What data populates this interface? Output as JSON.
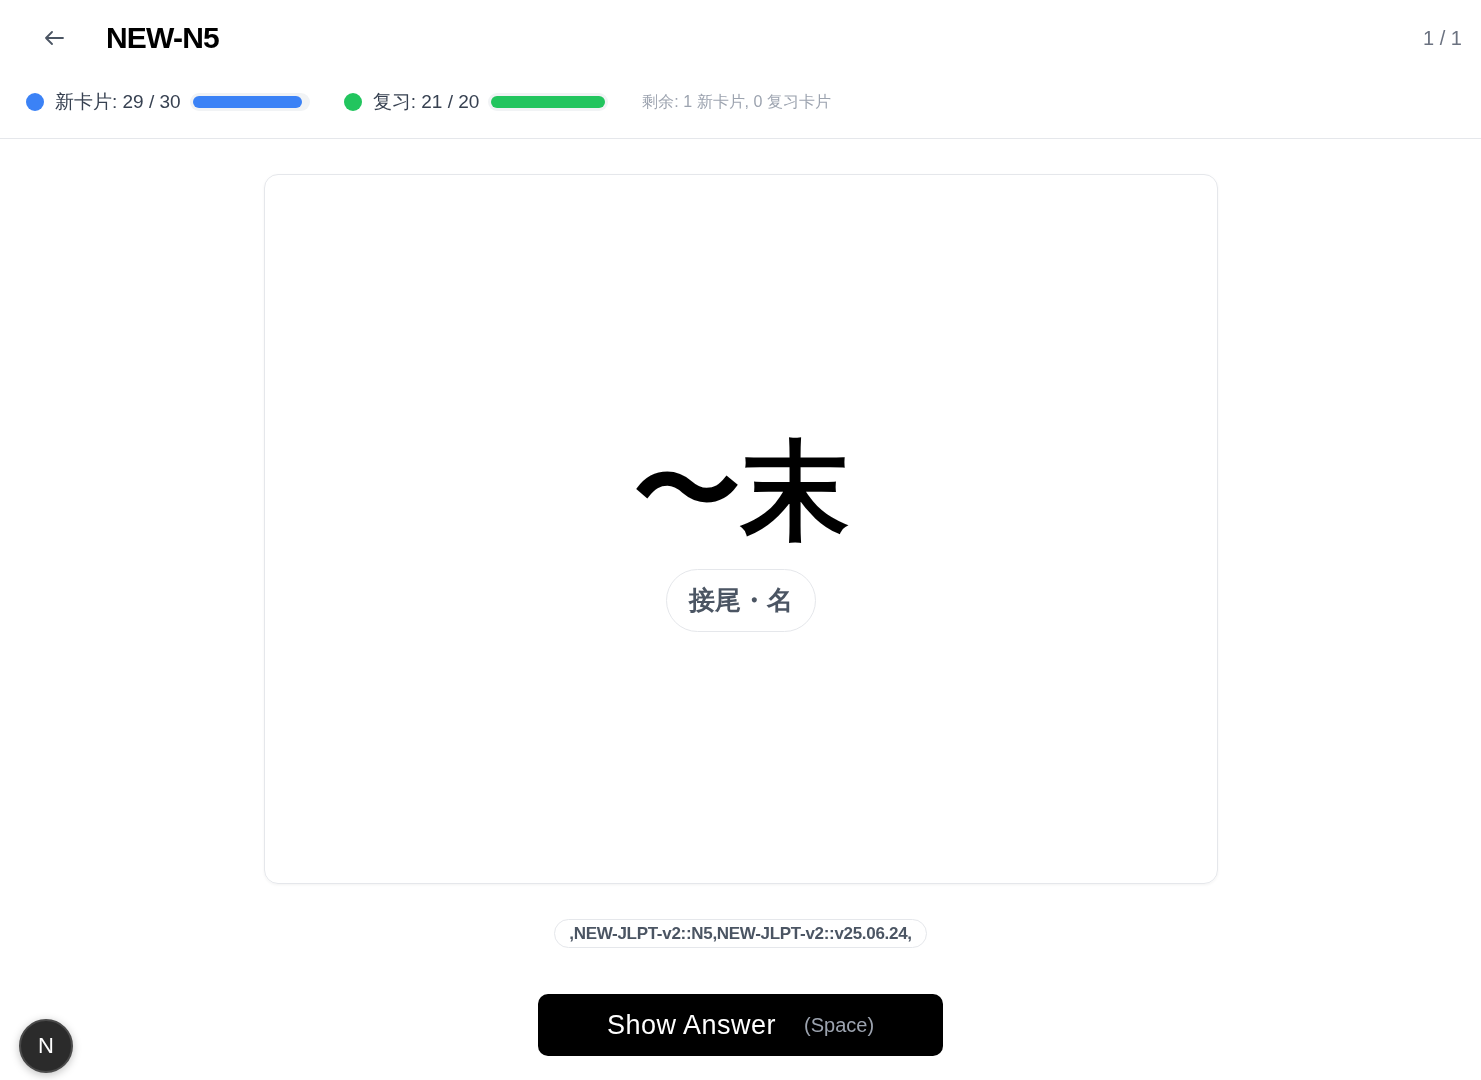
{
  "header": {
    "title": "NEW-N5",
    "counter": "1 / 1"
  },
  "progress": [
    {
      "label": "新卡片: 29 / 30",
      "color": "#3b82f6",
      "level": 0.96
    },
    {
      "label": "复习: 21 / 20",
      "color": "#22c55e",
      "level": 1
    }
  ],
  "remaining": "剩余: 1 新卡片, 0 复习卡片",
  "card": {
    "word": "〜末",
    "part_of_speech": "接尾・名"
  },
  "tags": ",NEW-JLPT-v2::N5,NEW-JLPT-v2::v25.06.24,",
  "show_answer": {
    "label": "Show Answer",
    "shortcut": "(Space)"
  },
  "dev_badge": {
    "label": "N"
  }
}
